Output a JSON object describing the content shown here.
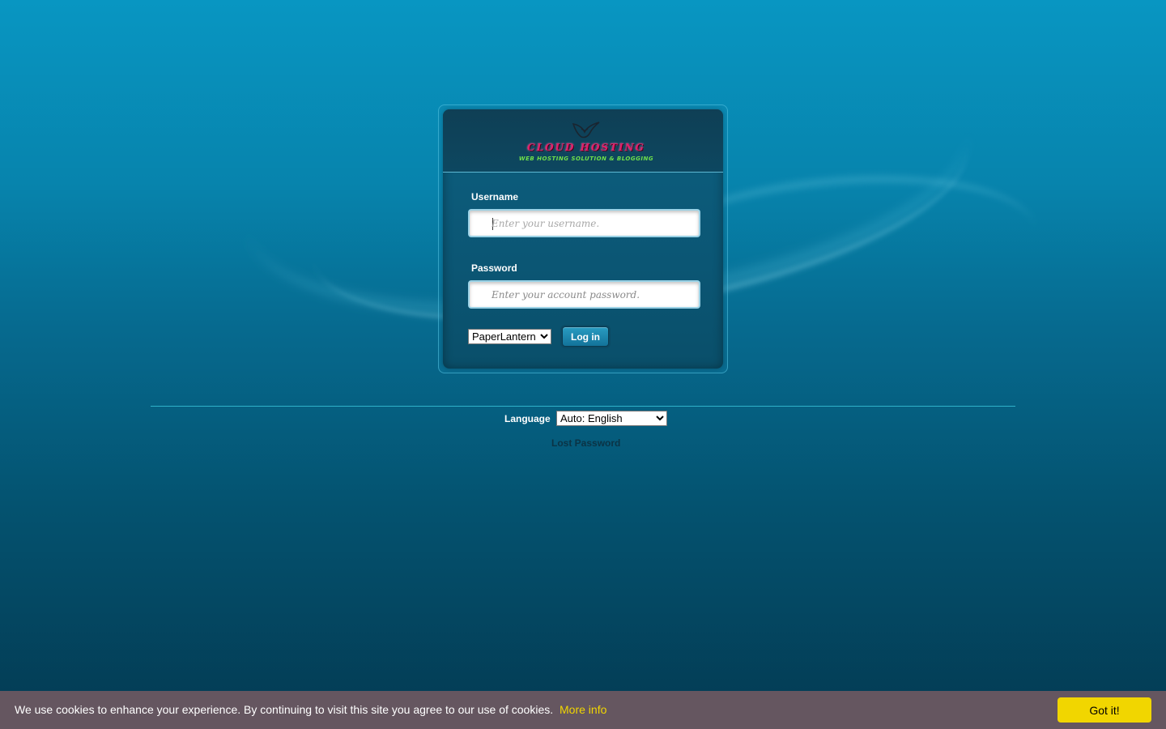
{
  "brand": {
    "logo_title": "CLOUD HOSTING",
    "logo_subtitle": "WEB HOSTING SOLUTION & BLOGGING"
  },
  "login": {
    "username_label": "Username",
    "username_placeholder": "Enter your username.",
    "password_label": "Password",
    "password_placeholder": "Enter your account password.",
    "theme_selected": "PaperLantern",
    "login_button": "Log in"
  },
  "footer": {
    "language_label": "Language",
    "language_selected": "Auto: English",
    "lost_password": "Lost Password"
  },
  "cookie": {
    "message": "We use cookies to enhance your experience. By continuing to visit this site you agree to our use of cookies.",
    "more_info": "More info",
    "accept_button": "Got it!"
  },
  "colors": {
    "background_top": "#0896c2",
    "background_bottom": "#033a52",
    "cookie_bar": "#655660",
    "cookie_accent": "#f1d600",
    "logo_title": "#e0206a",
    "logo_subtitle": "#6fe04a"
  }
}
